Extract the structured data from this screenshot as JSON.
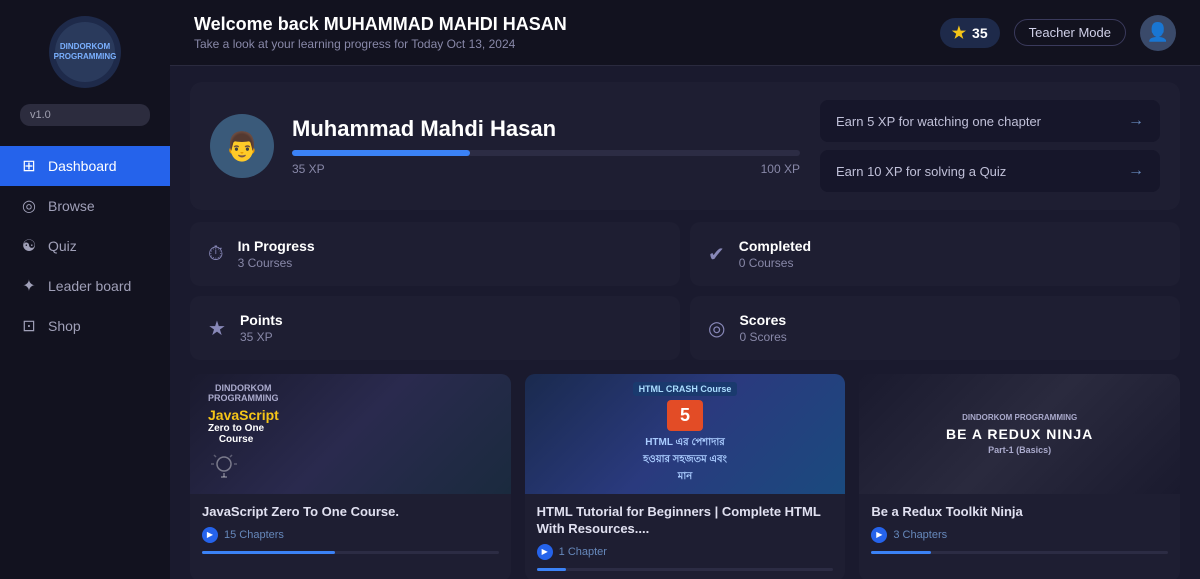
{
  "app": {
    "logo_line1": "DINDORKOM",
    "logo_line2": "PROGRAMMING",
    "version": "v1.0"
  },
  "sidebar": {
    "items": [
      {
        "id": "dashboard",
        "label": "Dashboard",
        "icon": "⊞",
        "active": true
      },
      {
        "id": "browse",
        "label": "Browse",
        "icon": "◎",
        "active": false
      },
      {
        "id": "quiz",
        "label": "Quiz",
        "icon": "☯",
        "active": false
      },
      {
        "id": "leaderboard",
        "label": "Leader board",
        "icon": "✦",
        "active": false
      },
      {
        "id": "shop",
        "label": "Shop",
        "icon": "⊡",
        "active": false
      }
    ]
  },
  "header": {
    "welcome": "Welcome back MUHAMMAD MAHDI HASAN",
    "subtitle": "Take a look at your learning progress for Today Oct 13, 2024",
    "xp": "35",
    "teacher_mode": "Teacher Mode"
  },
  "profile": {
    "name": "Muhammad Mahdi Hasan",
    "xp_current": "35 XP",
    "xp_max": "100 XP",
    "xp_percent": 35,
    "actions": [
      {
        "label": "Earn 5 XP for watching one chapter"
      },
      {
        "label": "Earn 10 XP for solving a Quiz"
      }
    ]
  },
  "stats": [
    {
      "icon": "⏱",
      "label": "In Progress",
      "value": "3 Courses"
    },
    {
      "icon": "✓",
      "label": "Completed",
      "value": "0 Courses"
    },
    {
      "icon": "★",
      "label": "Points",
      "value": "35 XP"
    },
    {
      "icon": "◎",
      "label": "Scores",
      "value": "0 Scores"
    }
  ],
  "courses": [
    {
      "title": "JavaScript Zero To One Course.",
      "thumb_type": "js",
      "js_label": "JavaScript",
      "js_course_name": "Zero to One\nCourse",
      "chapters": "15 Chapters",
      "progress": 45
    },
    {
      "title": "HTML Tutorial for Beginners | Complete HTML With Resources....",
      "thumb_type": "html",
      "html_subtitle": "HTML CRASH Course",
      "chapters": "1 Chapter",
      "progress": 10
    },
    {
      "title": "Be a Redux Toolkit Ninja",
      "thumb_type": "redux",
      "redux_title": "BE A\nREDUX\nNINJA",
      "redux_sub": "Part-1\n(Basics)",
      "chapters": "3 Chapters",
      "progress": 20
    }
  ]
}
